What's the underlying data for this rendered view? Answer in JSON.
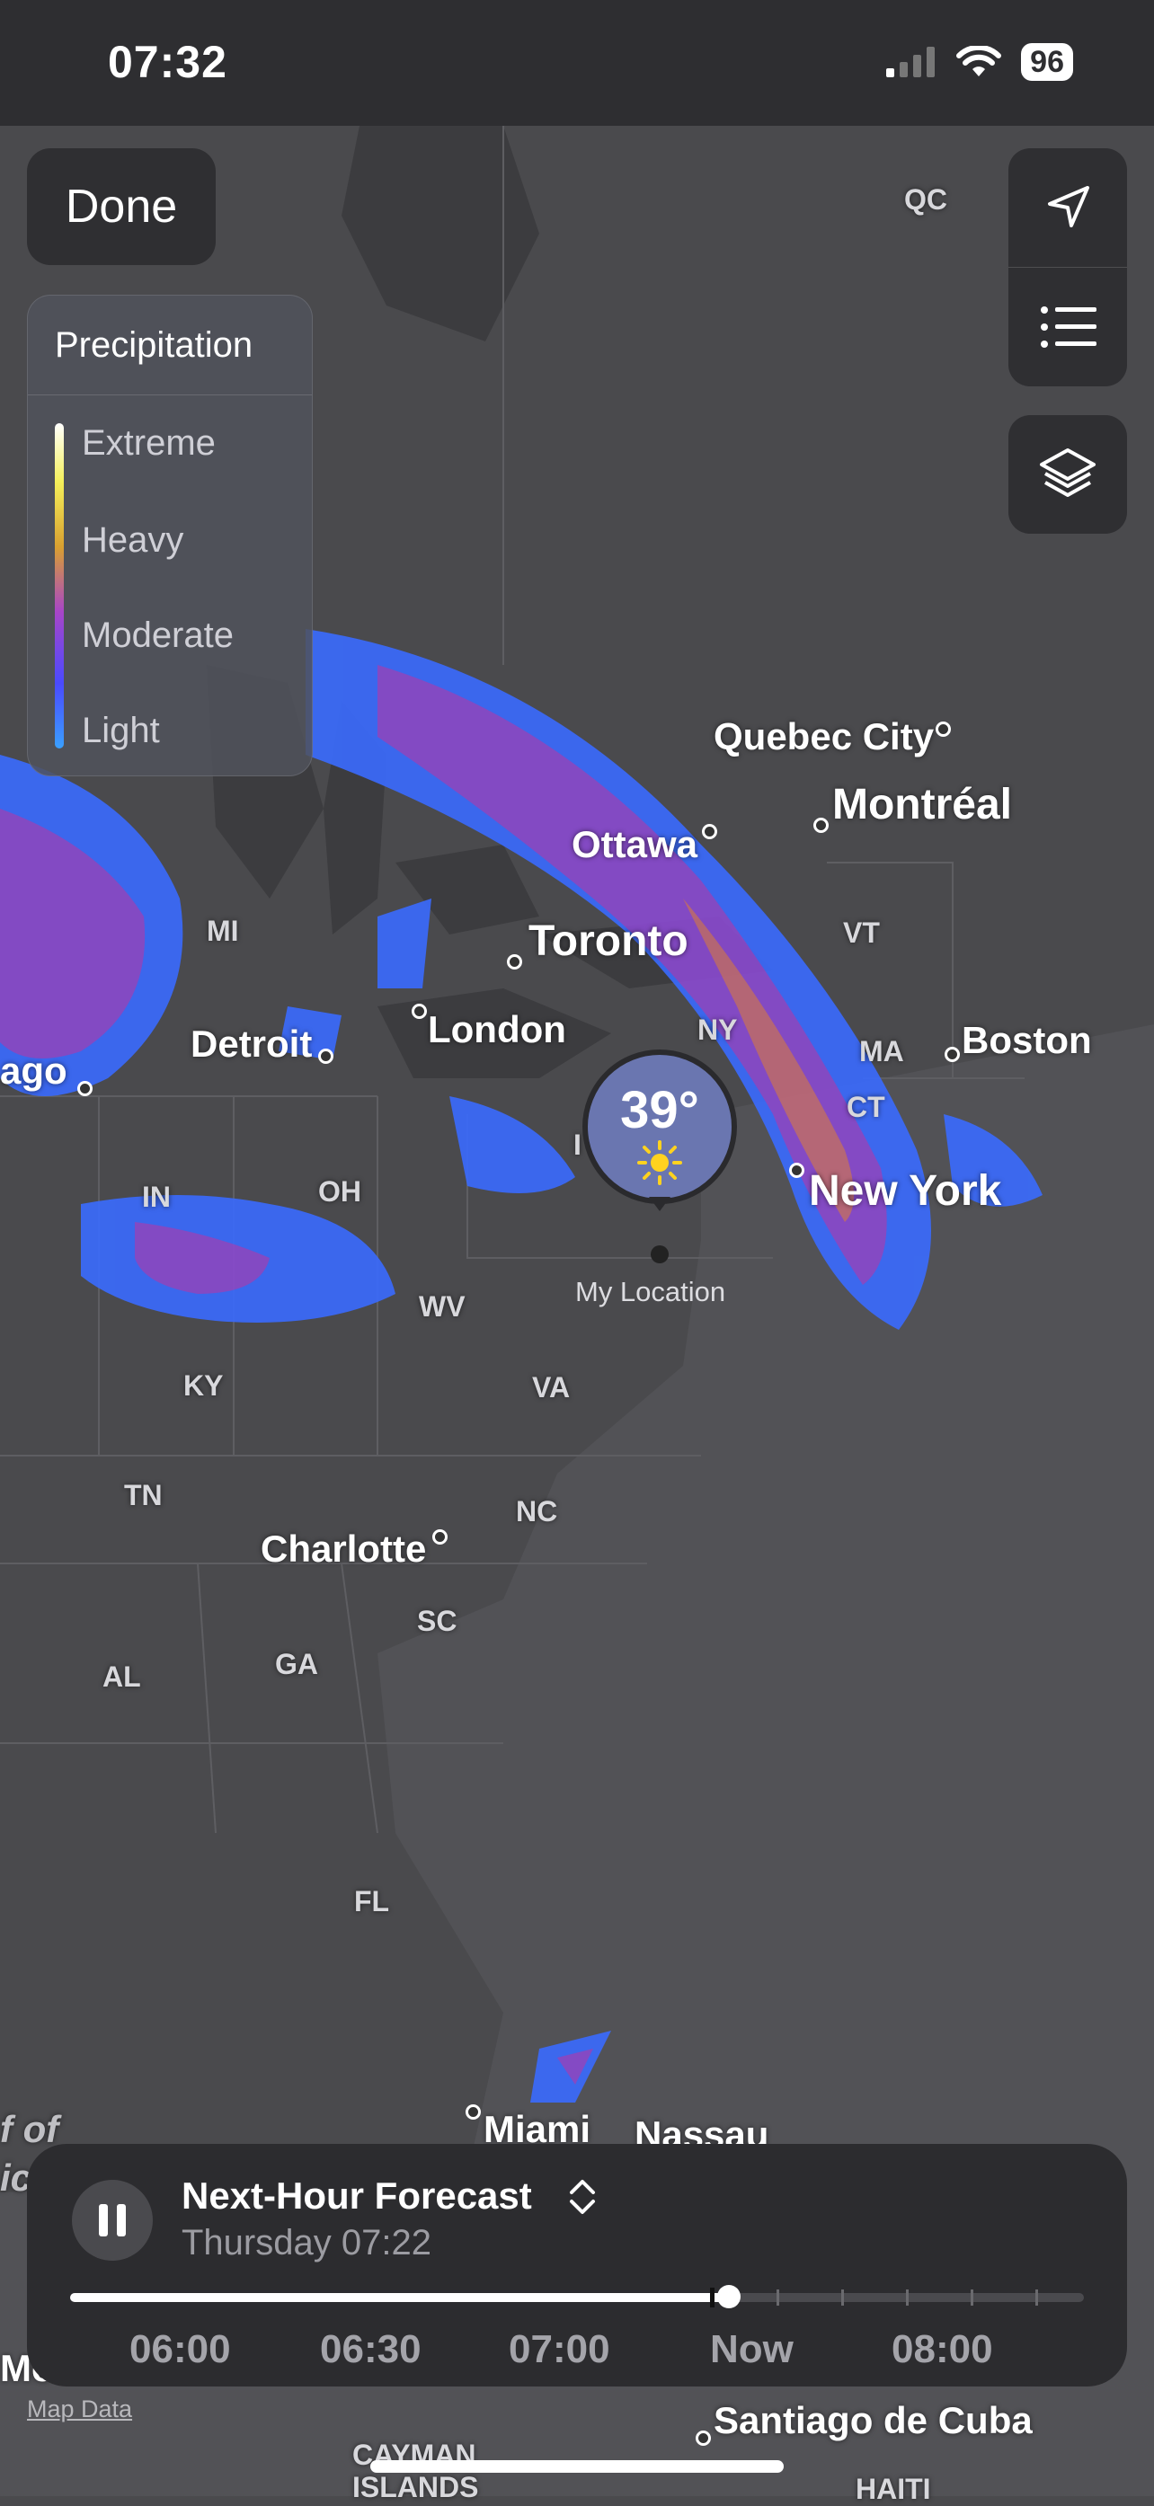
{
  "status_bar": {
    "time": "07:32",
    "battery": "96"
  },
  "top": {
    "done_label": "Done"
  },
  "legend": {
    "title": "Precipitation",
    "levels": [
      "Extreme",
      "Heavy",
      "Moderate",
      "Light"
    ]
  },
  "map": {
    "cities": {
      "quebec_city": "Quebec City",
      "montreal": "Montréal",
      "ottawa": "Ottawa",
      "toronto": "Toronto",
      "london": "London",
      "detroit": "Detroit",
      "chicago": "ago",
      "boston": "Boston",
      "new_york": "New York",
      "charlotte": "Charlotte",
      "miami": "Miami",
      "nassau": "Nassau",
      "santiago": "Santiago de Cuba",
      "cayman": "CAYMAN",
      "islands": "ISLANDS",
      "haiti": "HAITI",
      "gulf_1": "f of",
      "gulf_2": "ic",
      "mex": "Me"
    },
    "states": {
      "qc": "QC",
      "mi": "MI",
      "vt": "VT",
      "ny": "NY",
      "ma": "MA",
      "ct": "CT",
      "in": "IN",
      "oh": "OH",
      "pa": "I",
      "wv": "WV",
      "ky": "KY",
      "va": "VA",
      "tn": "TN",
      "nc": "NC",
      "sc": "SC",
      "ga": "GA",
      "al": "AL",
      "fl": "FL"
    },
    "location": {
      "temperature": "39°",
      "label": "My Location",
      "condition_icon": "sun-icon"
    }
  },
  "forecast": {
    "title": "Next-Hour Forecast",
    "subtitle": "Thursday 07:22",
    "progress": 0.65,
    "times": [
      "06:00",
      "06:30",
      "07:00",
      "Now",
      "08:00"
    ]
  },
  "footer": {
    "map_data": "Map Data"
  },
  "colors": {
    "panel": "#2c2c2f",
    "map_land": "#4a4a4d",
    "legend_light": "#3aa0ff",
    "legend_extreme": "#ffffff"
  }
}
